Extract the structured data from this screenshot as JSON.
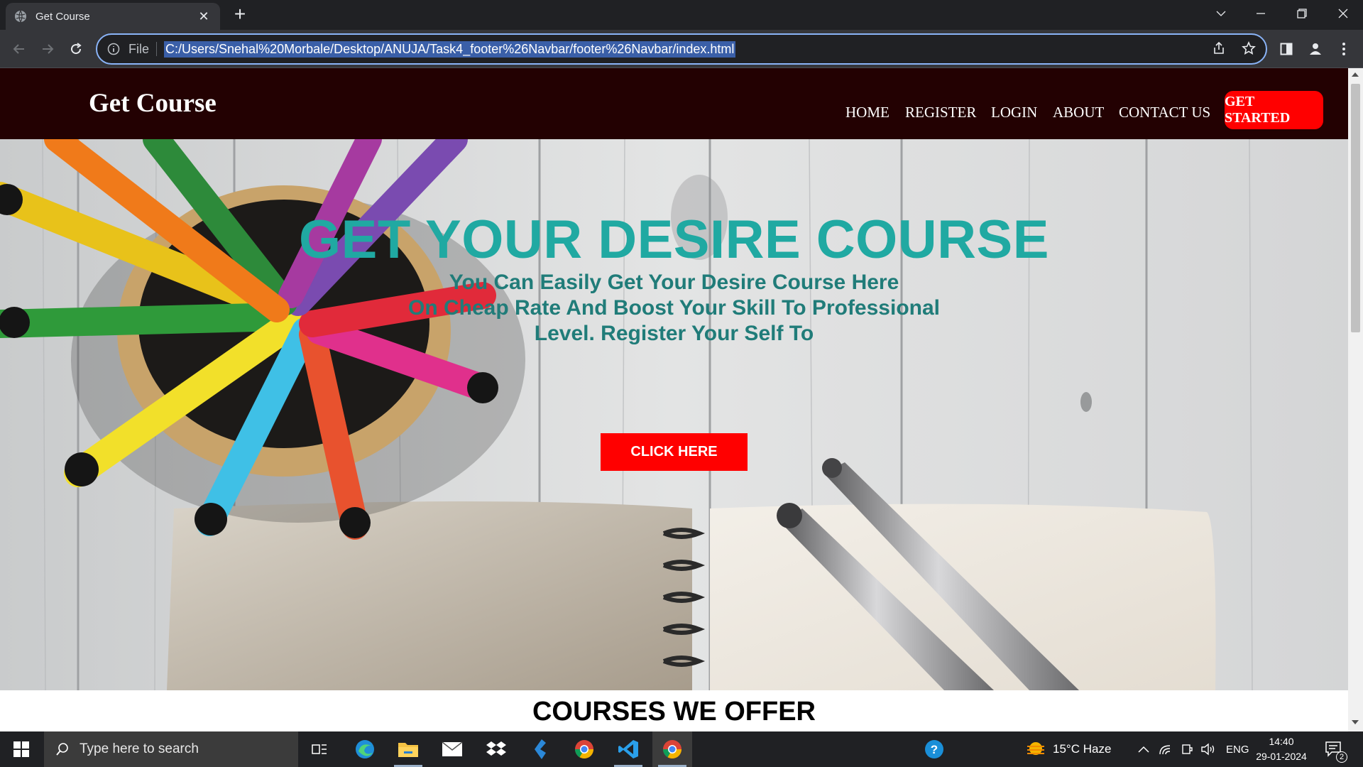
{
  "browser": {
    "tab_title": "Get Course",
    "scheme_label": "File",
    "url": "C:/Users/Snehal%20Morbale/Desktop/ANUJA/Task4_footer%26Navbar/footer%26Navbar/index.html"
  },
  "site": {
    "brand": "Get Course",
    "menu": [
      "HOME",
      "REGISTER",
      "LOGIN",
      "ABOUT",
      "CONTACT US"
    ],
    "cta_label": "GET STARTED"
  },
  "hero": {
    "heading": "GET YOUR DESIRE COURSE",
    "subtitle_lines": [
      "You Can Easily Get Your Desire Course Here",
      "On Cheap Rate And Boost Your Skill To Professional",
      "Level. Register Your Self To"
    ],
    "button_label": "CLICK HERE"
  },
  "courses": {
    "title": "COURSES WE OFFER"
  },
  "taskbar": {
    "search_placeholder": "Type here to search",
    "apps": [
      "task-view",
      "edge",
      "file-explorer",
      "mail",
      "dropbox",
      "power-automate",
      "chrome-alt",
      "vscode",
      "chrome"
    ],
    "weather": "15°C  Haze",
    "language": "ENG",
    "time": "14:40",
    "date": "29-01-2024",
    "notification_count": "2"
  },
  "colors": {
    "nav_bg": "#230102",
    "accent_red": "#ff0000",
    "hero_heading": "#20a9a2",
    "hero_sub": "#207c79"
  }
}
